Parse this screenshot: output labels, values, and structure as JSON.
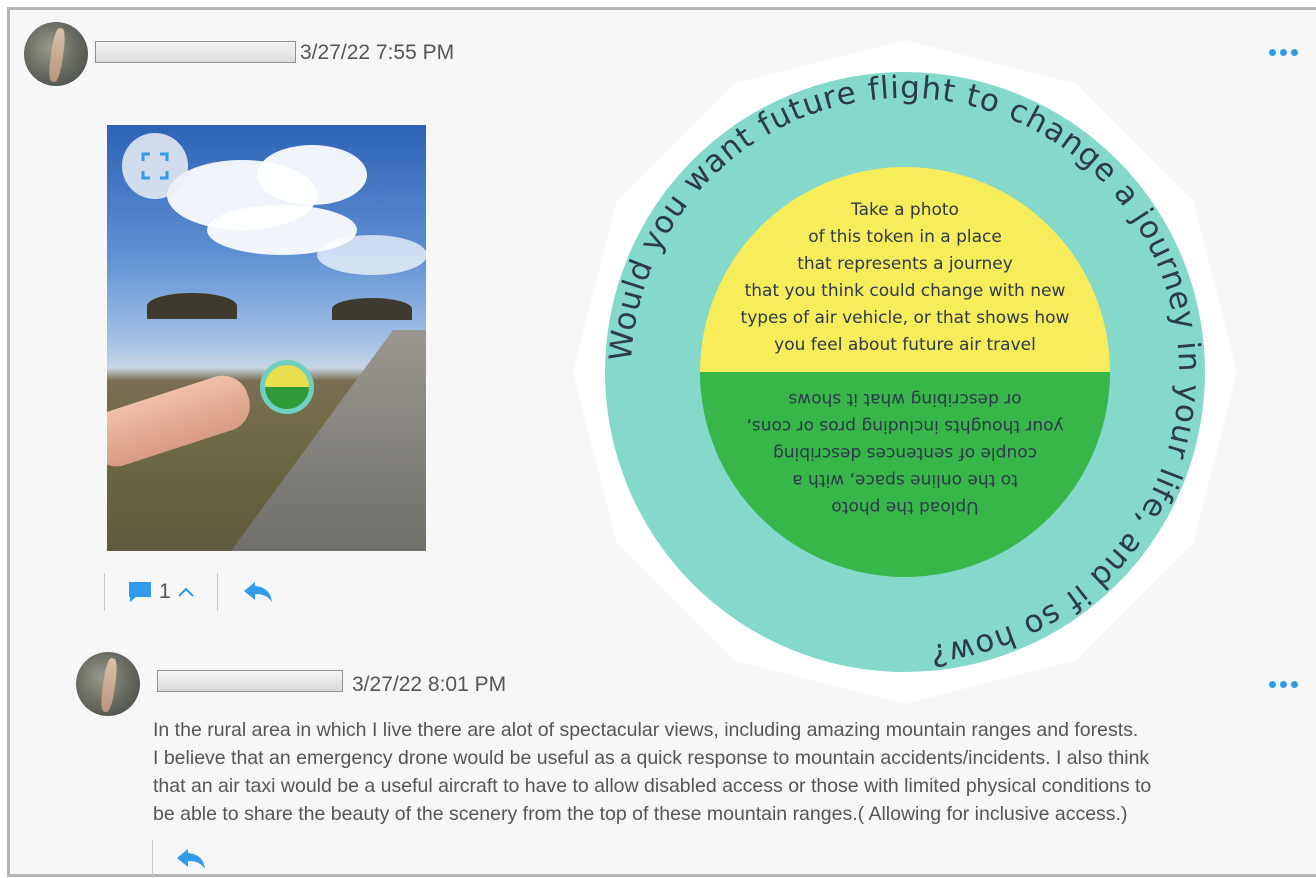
{
  "post": {
    "timestamp": "3/27/22 7:55 PM",
    "comment_count": "1"
  },
  "token_graphic": {
    "outer_text": "Would you want future flight to change a journey in your life, and if so how?",
    "upper_lines": [
      "Take a photo",
      "of this token in a place",
      "that represents a journey",
      "that you think could change with new",
      "types of air vehicle, or that shows how",
      "you feel about future air travel"
    ],
    "lower_lines": [
      "Upload the photo",
      "to the online space, with a",
      "couple of sentences describing",
      "your thoughts including pros or cons,",
      "or describing what it shows"
    ],
    "colors": {
      "ring": "#84d9cb",
      "upper": "#f7ec5a",
      "lower": "#38b64a",
      "text": "#2d3a4a"
    }
  },
  "reply": {
    "timestamp": "3/27/22 8:01 PM",
    "lines": [
      "In the rural area in which I live there are alot of spectacular views, including amazing mountain ranges and forests.",
      "I believe that an emergency drone would be useful as a quick response to mountain accidents/incidents. I also think",
      "that an air taxi would be a useful aircraft to have to allow disabled access or those with limited physical conditions to",
      "be able to share the beauty  of the scenery from the top of these mountain ranges.( Allowing for inclusive access.)"
    ]
  },
  "icons": {
    "more": "more-horizontal-icon",
    "expand": "expand-icon",
    "comment": "comment-icon",
    "reply": "reply-icon",
    "chevron": "chevron-up-icon"
  },
  "accent_color": "#2f9bea"
}
